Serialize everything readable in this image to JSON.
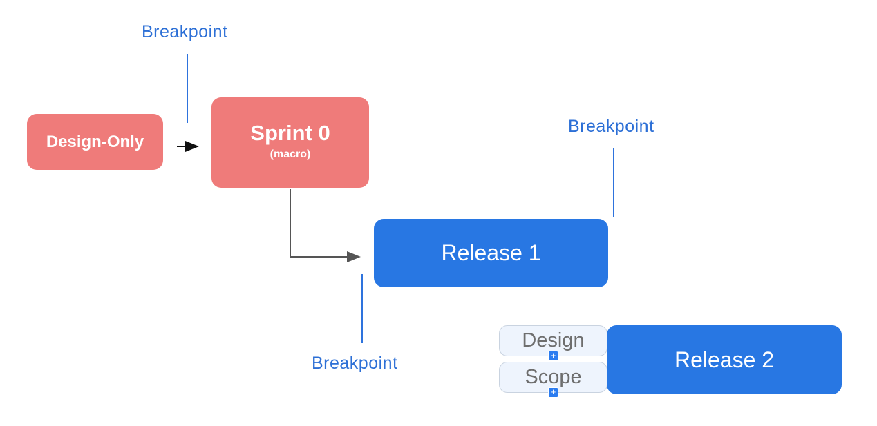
{
  "nodes": {
    "design_only": {
      "label": "Design-Only",
      "color": "#ef7b7a"
    },
    "sprint0": {
      "label": "Sprint 0",
      "sublabel": "(macro)",
      "color": "#ef7b7a"
    },
    "release1": {
      "label": "Release 1",
      "color": "#2877e3"
    },
    "release2": {
      "label": "Release 2",
      "color": "#2877e3"
    }
  },
  "breakpoints": [
    {
      "label": "Breakpoint"
    },
    {
      "label": "Breakpoint"
    },
    {
      "label": "Breakpoint"
    }
  ],
  "release2_tags": [
    {
      "label": "Design",
      "icon": "plus-icon"
    },
    {
      "label": "Scope",
      "icon": "plus-icon"
    }
  ],
  "edges": [
    {
      "from": "Design-Only",
      "to": "Sprint 0"
    },
    {
      "from": "Sprint 0",
      "to": "Release 1"
    }
  ]
}
